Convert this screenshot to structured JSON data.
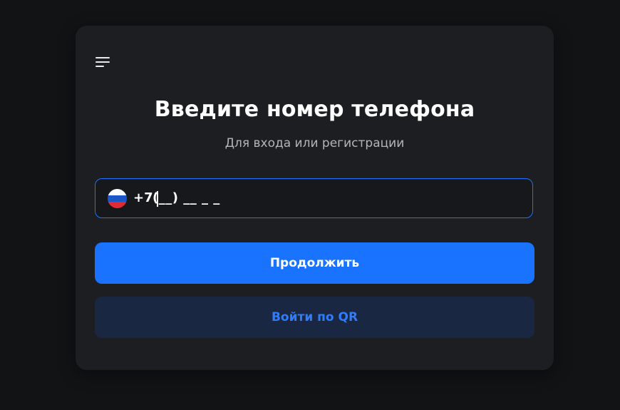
{
  "header": {
    "menu_icon": "hamburger-menu-icon"
  },
  "login": {
    "title": "Введите номер телефона",
    "subtitle": "Для входа или регистрации"
  },
  "phone_input": {
    "country_flag": "russia-flag-icon",
    "country_code": "+7",
    "mask": "(__) __ _ _"
  },
  "buttons": {
    "continue_label": "Продолжить",
    "qr_label": "Войти по QR"
  },
  "colors": {
    "background": "#121315",
    "card": "#1d1e21",
    "accent": "#1a73ff",
    "secondary_button": "#1a2743",
    "secondary_text": "#2c7dff"
  }
}
